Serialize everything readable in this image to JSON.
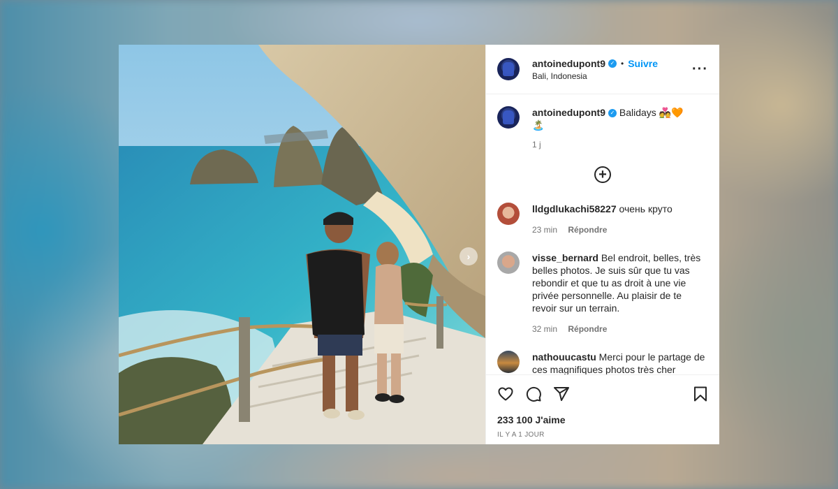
{
  "post": {
    "username": "antoinedupont9",
    "follow_label": "Suivre",
    "location": "Bali, Indonesia",
    "more_icon": "more-dots-icon",
    "caption": "Balidays 💑🧡",
    "caption_line2": "🏝️",
    "caption_time": "1 j",
    "load_more_icon": "plus-circle-icon"
  },
  "comments": [
    {
      "username": "lldgdlukachi58227",
      "text": "очень круто",
      "time": "23 min",
      "reply": "Répondre"
    },
    {
      "username": "visse_bernard",
      "text": "Bel endroit, belles, très belles photos. Je suis sûr que tu vas rebondir et que tu as droit à une vie privée personnelle. Au plaisir de te revoir sur un terrain.",
      "time": "32 min",
      "reply": "Répondre"
    },
    {
      "username": "nathouucastu",
      "text": "Merci pour le partage de ces magnifiques photos très cher",
      "time": "",
      "reply": ""
    }
  ],
  "actions": {
    "icons": [
      "heart-icon",
      "comment-icon",
      "share-icon",
      "bookmark-icon"
    ],
    "likes": "233 100 J'aime",
    "posted_ago": "IL Y A 1 JOUR"
  },
  "colors": {
    "follow": "#0095f6",
    "verified": "#1d9bf0",
    "text": "#262626",
    "muted": "#737373"
  }
}
